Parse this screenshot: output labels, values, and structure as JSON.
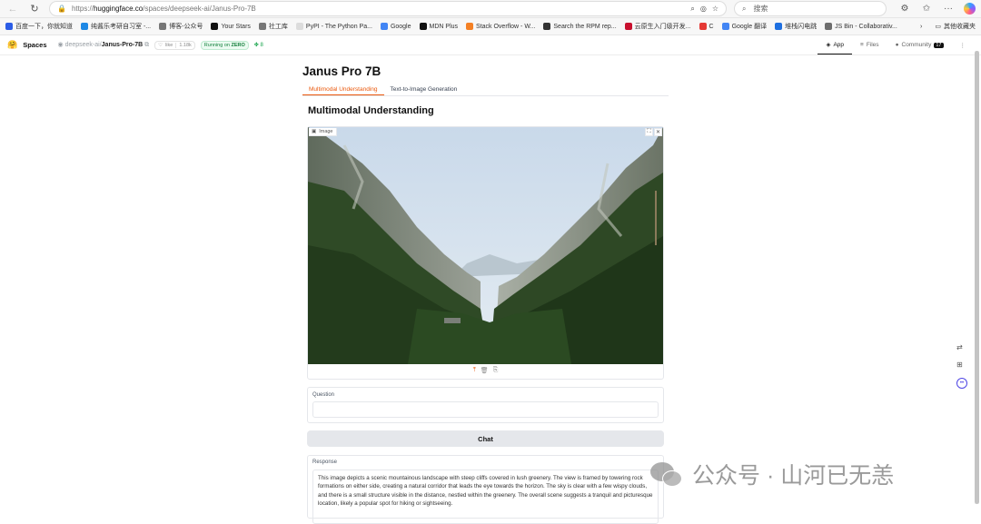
{
  "browser": {
    "url_prefix": "https://",
    "url_domain": "huggingface.co",
    "url_path": "/spaces/deepseek-ai/Janus-Pro-7B",
    "search_placeholder": "搜索"
  },
  "bookmarks": [
    {
      "label": "百度一下，你就知道",
      "color": "#2b5ce6"
    },
    {
      "label": "纯酱乐考研自习室 -...",
      "color": "#1e88e5"
    },
    {
      "label": "博客-公众号",
      "color": "#777777"
    },
    {
      "label": "Your Stars",
      "color": "#111111"
    },
    {
      "label": "社工库",
      "color": "#777777"
    },
    {
      "label": "PyPI - The Python Pa...",
      "color": "#dcdcdc"
    },
    {
      "label": "Google",
      "color": "#4285f4"
    },
    {
      "label": "MDN Plus",
      "color": "#111111"
    },
    {
      "label": "Stack Overflow - W...",
      "color": "#f48024"
    },
    {
      "label": "Search the RPM rep...",
      "color": "#333333"
    },
    {
      "label": "云原生入门级开发...",
      "color": "#c8102e"
    },
    {
      "label": "C",
      "color": "#e53935"
    },
    {
      "label": "Google 翻译",
      "color": "#4285f4"
    },
    {
      "label": "堆栈闪电跳",
      "color": "#1e6fe0"
    },
    {
      "label": "JS Bin - Collaborativ...",
      "color": "#6d6d6d"
    }
  ],
  "bookmarks_other": "其他收藏夹",
  "hf": {
    "spaces": "Spaces",
    "org": "deepseek-ai",
    "repo": "Janus-Pro-7B",
    "like_label": "like",
    "like_count": "1.18k",
    "running_prefix": "Running on",
    "running_hw": "ZERO",
    "count": "8",
    "tabs": [
      "App",
      "Files",
      "Community"
    ],
    "community_count": "17"
  },
  "app": {
    "title": "Janus Pro 7B",
    "tabs": [
      "Multimodal Understanding",
      "Text-to-Image Generation"
    ],
    "section_title": "Multimodal Understanding",
    "image_label": "Image",
    "question_label": "Question",
    "question_value": "",
    "chat_label": "Chat",
    "response_label": "Response",
    "response_text": "This image depicts a scenic mountainous landscape with steep cliffs covered in lush greenery. The view is framed by towering rock formations on either side, creating a natural corridor that leads the eye towards the horizon. The sky is clear with a few wispy clouds, and there is a small structure visible in the distance, nestled within the greenery. The overall scene suggests a tranquil and picturesque location, likely a popular spot for hiking or sightseeing."
  },
  "watermark": {
    "text": "公众号 · 山河已无恙"
  },
  "colors": {
    "accent": "#ea580c",
    "running_green": "#15803d"
  }
}
